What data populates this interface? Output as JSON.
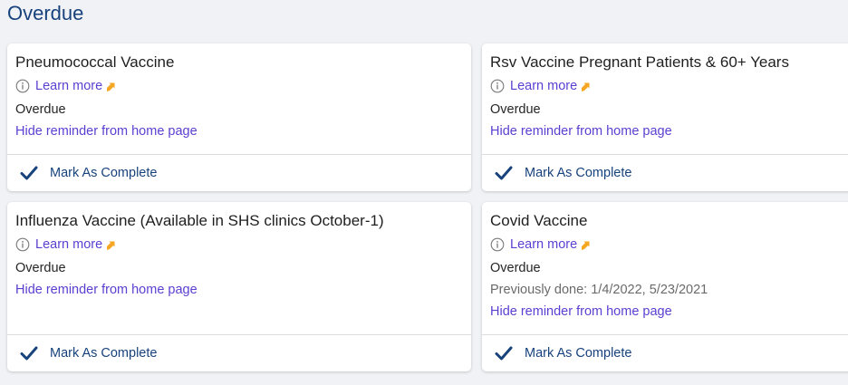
{
  "section": {
    "title": "Overdue"
  },
  "icons": {
    "info": "info-circle-icon",
    "external": "external-link-arrow-icon",
    "check": "checkmark-icon"
  },
  "colors": {
    "title": "#17427c",
    "link": "#5b3fd1",
    "external_arrow": "#f5a623",
    "check": "#17427c"
  },
  "cards": [
    {
      "title": "Pneumococcal Vaccine",
      "learn_more": "Learn more",
      "status": "Overdue",
      "previously_done": "",
      "hide_link": "Hide reminder from home page",
      "complete_label": "Mark As Complete"
    },
    {
      "title": "Rsv Vaccine Pregnant Patients & 60+ Years",
      "learn_more": "Learn more",
      "status": "Overdue",
      "previously_done": "",
      "hide_link": "Hide reminder from home page",
      "complete_label": "Mark As Complete"
    },
    {
      "title": "Influenza Vaccine (Available in SHS clinics October-1)",
      "learn_more": "Learn more",
      "status": "Overdue",
      "previously_done": "",
      "hide_link": "Hide reminder from home page",
      "complete_label": "Mark As Complete"
    },
    {
      "title": "Covid Vaccine",
      "learn_more": "Learn more",
      "status": "Overdue",
      "previously_done": "Previously done: 1/4/2022, 5/23/2021",
      "hide_link": "Hide reminder from home page",
      "complete_label": "Mark As Complete"
    }
  ]
}
